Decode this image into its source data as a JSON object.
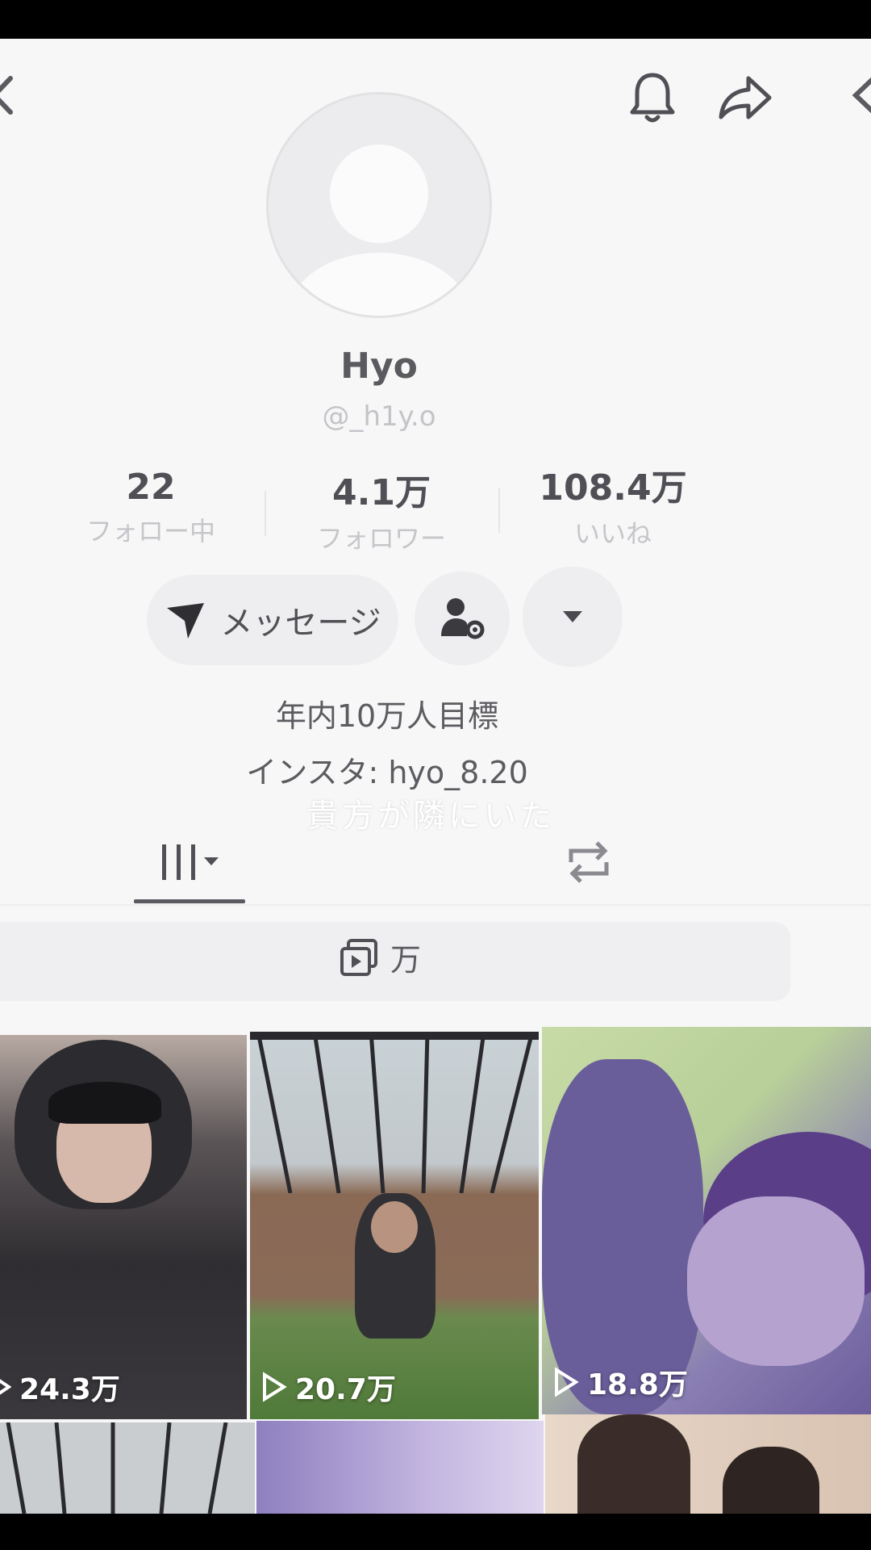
{
  "header": {
    "icons": [
      "back-icon",
      "bell-icon",
      "share-icon",
      "chevron-left-icon"
    ]
  },
  "profile": {
    "name": "Hyo",
    "handle": "@_h1y.o"
  },
  "stats": [
    {
      "value": "22",
      "label": "フォロー中"
    },
    {
      "value": "4.1万",
      "label": "フォロワー"
    },
    {
      "value": "108.4万",
      "label": "いいね"
    }
  ],
  "actions": {
    "message_label": "メッセージ",
    "message_icon": "paper-plane-icon",
    "settings_icon": "user-settings-icon",
    "more_icon": "caret-down-icon"
  },
  "bio": {
    "line1": "年内10万人目標",
    "line2": "インスタ: hyo_8.20"
  },
  "overlay_caption": "貴方が隣にいた",
  "tabs": [
    {
      "icon": "grid-icon"
    },
    {
      "icon": "repost-icon"
    }
  ],
  "filter": {
    "label": "万",
    "icon": "collection-icon"
  },
  "videos": [
    {
      "views": "24.3万"
    },
    {
      "views": "20.7万"
    },
    {
      "views": "18.8万"
    },
    {
      "views": ""
    },
    {
      "views": ""
    },
    {
      "views": ""
    }
  ],
  "colors": {
    "background": "#f7f7f8",
    "text": "#5a5a5f",
    "muted": "#c6c6ca"
  }
}
